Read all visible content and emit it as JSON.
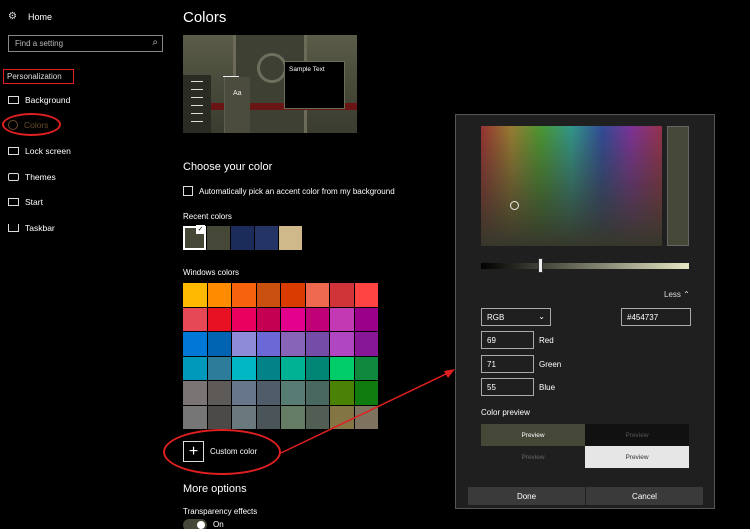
{
  "sidebar": {
    "home": "Home",
    "search_placeholder": "Find a setting",
    "section": "Personalization",
    "items": [
      {
        "label": "Background",
        "icon": "picture-icon"
      },
      {
        "label": "Colors",
        "icon": "palette-icon"
      },
      {
        "label": "Lock screen",
        "icon": "monitor-icon"
      },
      {
        "label": "Themes",
        "icon": "brush-icon"
      },
      {
        "label": "Start",
        "icon": "start-grid-icon"
      },
      {
        "label": "Taskbar",
        "icon": "taskbar-icon"
      }
    ]
  },
  "main": {
    "title": "Colors",
    "preview_sample": "Sample Text",
    "preview_tile": "Aa",
    "choose_heading": "Choose your color",
    "auto_pick": "Automatically pick an accent color from my background",
    "recent_label": "Recent colors",
    "recent_colors": [
      "#454737",
      "#454737",
      "#1c2c5a",
      "#243565",
      "#cfb98a"
    ],
    "windows_label": "Windows colors",
    "windows_colors": [
      "#ffb900",
      "#ff8c00",
      "#f7630c",
      "#ca5010",
      "#da3b01",
      "#ef6950",
      "#d13438",
      "#ff4343",
      "#e74856",
      "#e81123",
      "#ea005e",
      "#c30052",
      "#e3008c",
      "#bf0077",
      "#c239b3",
      "#9a0089",
      "#0078d7",
      "#0063b1",
      "#8e8cd8",
      "#6b69d6",
      "#8764b8",
      "#744da9",
      "#b146c2",
      "#881798",
      "#0099bc",
      "#2d7d9a",
      "#00b7c3",
      "#038387",
      "#00b294",
      "#018574",
      "#00cc6a",
      "#10893e",
      "#7a7574",
      "#5d5a58",
      "#68768a",
      "#515c6b",
      "#567c73",
      "#486860",
      "#498205",
      "#107c10",
      "#767676",
      "#4c4a48",
      "#69797e",
      "#4a5459",
      "#647c64",
      "#525e54",
      "#847545",
      "#7e735f"
    ],
    "custom_color": "Custom color",
    "more_options": "More options",
    "transparency": "Transparency effects",
    "toggle_state": "On"
  },
  "dialog": {
    "less": "Less",
    "mode": "RGB",
    "hex": "#454737",
    "red": "69",
    "green": "71",
    "blue": "55",
    "red_label": "Red",
    "green_label": "Green",
    "blue_label": "Blue",
    "preview_label": "Color preview",
    "preview": "Preview",
    "done": "Done",
    "cancel": "Cancel",
    "current_color": "#454737"
  }
}
